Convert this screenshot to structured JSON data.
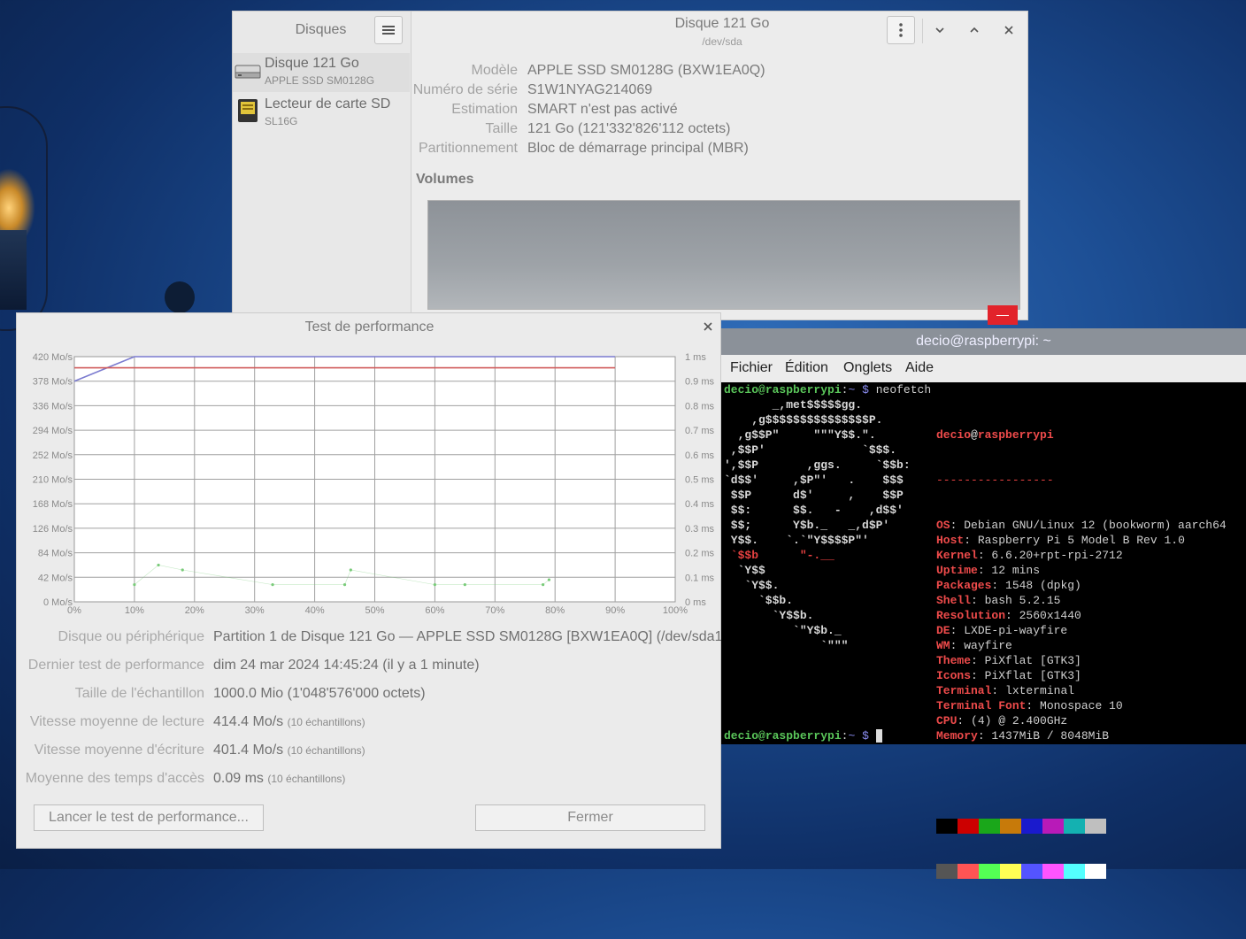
{
  "disks": {
    "sidebar_title": "Disques",
    "devices": [
      {
        "name": "Disque 121 Go",
        "model": "APPLE SSD SM0128G"
      },
      {
        "name": "Lecteur de carte SD",
        "model": "SL16G"
      }
    ],
    "title": "Disque 121 Go",
    "subtitle": "/dev/sda",
    "props": [
      {
        "key": "Modèle",
        "value": "APPLE SSD SM0128G (BXW1EA0Q)"
      },
      {
        "key": "Numéro de série",
        "value": "S1W1NYAG214069"
      },
      {
        "key": "Estimation",
        "value": "SMART n'est pas activé"
      },
      {
        "key": "Taille",
        "value": "121 Go (121'332'826'112 octets)"
      },
      {
        "key": "Partitionnement",
        "value": "Bloc de démarrage principal (MBR)"
      }
    ],
    "volumes_label": "Volumes",
    "volume_minus": "—"
  },
  "perf": {
    "title": "Test de performance",
    "rows": [
      {
        "label": "Disque ou périphérique",
        "value": "Partition 1 de Disque 121 Go — APPLE SSD SM0128G [BXW1EA0Q] (/dev/sda1)",
        "sub": ""
      },
      {
        "label": "Dernier test de performance",
        "value": "dim 24 mar 2024 14:45:24 (il y a 1 minute)",
        "sub": ""
      },
      {
        "label": "Taille de l'échantillon",
        "value": "1000.0 Mio (1'048'576'000 octets)",
        "sub": ""
      },
      {
        "label": "Vitesse moyenne de lecture",
        "value": "414.4 Mo/s",
        "sub": "(10 échantillons)"
      },
      {
        "label": "Vitesse moyenne d'écriture",
        "value": "401.4 Mo/s",
        "sub": "(10 échantillons)"
      },
      {
        "label": "Moyenne des temps d'accès",
        "value": "0.09 ms",
        "sub": "(10 échantillons)"
      }
    ],
    "btn_start": "Lancer le test de performance...",
    "btn_close": "Fermer"
  },
  "chart_data": {
    "type": "line",
    "title": "",
    "x_ticks": [
      "0%",
      "10%",
      "20%",
      "30%",
      "40%",
      "50%",
      "60%",
      "70%",
      "80%",
      "90%",
      "100%"
    ],
    "y_left_ticks": [
      "420 Mo/s",
      "378 Mo/s",
      "336 Mo/s",
      "294 Mo/s",
      "252 Mo/s",
      "210 Mo/s",
      "168 Mo/s",
      "126 Mo/s",
      "84 Mo/s",
      "42 Mo/s",
      "0 Mo/s"
    ],
    "y_right_ticks": [
      "1 ms",
      "0.9 ms",
      "0.8 ms",
      "0.7 ms",
      "0.6 ms",
      "0.5 ms",
      "0.4 ms",
      "0.3 ms",
      "0.2 ms",
      "0.1 ms",
      "0 ms"
    ],
    "ylim_left": [
      0,
      420
    ],
    "ylim_right": [
      0,
      1
    ],
    "xlim": [
      0,
      100
    ],
    "grid": true,
    "series": [
      {
        "kind": "read",
        "color": "#7b7bd0",
        "x": [
          0,
          10,
          20,
          30,
          40,
          50,
          60,
          70,
          80,
          90
        ],
        "y": [
          378,
          420,
          420,
          420,
          420,
          420,
          420,
          420,
          420,
          420
        ]
      },
      {
        "kind": "write",
        "color": "#d05b5b",
        "x": [
          0,
          10,
          20,
          30,
          40,
          50,
          60,
          70,
          80,
          90
        ],
        "y": [
          401,
          401,
          401,
          401,
          401,
          401,
          401,
          401,
          401,
          401
        ]
      },
      {
        "kind": "access",
        "color": "#7acb7a",
        "x": [
          10,
          14,
          18,
          33,
          45,
          46,
          60,
          65,
          78,
          79
        ],
        "y": [
          0.07,
          0.15,
          0.13,
          0.07,
          0.07,
          0.13,
          0.07,
          0.07,
          0.07,
          0.09
        ]
      }
    ]
  },
  "terminal": {
    "title": "decio@raspberrypi: ~",
    "menu": [
      "Fichier",
      "Édition",
      "Onglets",
      "Aide"
    ],
    "user": "decio",
    "host": "raspberrypi",
    "prompt_sep": ":",
    "prompt_path": "~",
    "prompt_dollar": "$",
    "command": "neofetch",
    "separator": "-----------------",
    "info": [
      {
        "k": "OS",
        "v": "Debian GNU/Linux 12 (bookworm) aarch64"
      },
      {
        "k": "Host",
        "v": "Raspberry Pi 5 Model B Rev 1.0"
      },
      {
        "k": "Kernel",
        "v": "6.6.20+rpt-rpi-2712"
      },
      {
        "k": "Uptime",
        "v": "12 mins"
      },
      {
        "k": "Packages",
        "v": "1548 (dpkg)"
      },
      {
        "k": "Shell",
        "v": "bash 5.2.15"
      },
      {
        "k": "Resolution",
        "v": "2560x1440"
      },
      {
        "k": "DE",
        "v": "LXDE-pi-wayfire"
      },
      {
        "k": "WM",
        "v": "wayfire"
      },
      {
        "k": "Theme",
        "v": "PiXflat [GTK3]"
      },
      {
        "k": "Icons",
        "v": "PiXflat [GTK3]"
      },
      {
        "k": "Terminal",
        "v": "lxterminal"
      },
      {
        "k": "Terminal Font",
        "v": "Monospace 10"
      },
      {
        "k": "CPU",
        "v": "(4) @ 2.400GHz"
      },
      {
        "k": "Memory",
        "v": "1437MiB / 8048MiB"
      }
    ],
    "ascii": [
      "       _,met$$$$$gg.",
      "    ,g$$$$$$$$$$$$$$$P.",
      "  ,g$$P\"     \"\"\"Y$$.\".",
      " ,$$P'              `$$$.",
      "',$$P       ,ggs.     `$$b:",
      "`d$$'     ,$P\"'   .    $$$",
      " $$P      d$'     ,    $$P",
      " $$:      $$.   -    ,d$$'",
      " $$;      Y$b._   _,d$P'",
      " Y$$.    `.`\"Y$$$$P\"'",
      " `$$b      \"-.__",
      "  `Y$$",
      "   `Y$$.",
      "     `$$b.",
      "       `Y$$b.",
      "          `\"Y$b._",
      "              `\"\"\""
    ],
    "colors_top": [
      "#000000",
      "#cc0000",
      "#1aa71a",
      "#c77a0a",
      "#1a1acd",
      "#b81ab8",
      "#14b1b1",
      "#bfbfbf"
    ],
    "colors_bottom": [
      "#555555",
      "#ff5454",
      "#54ff54",
      "#ffff54",
      "#5454ff",
      "#ff54ff",
      "#54ffff",
      "#ffffff"
    ]
  }
}
